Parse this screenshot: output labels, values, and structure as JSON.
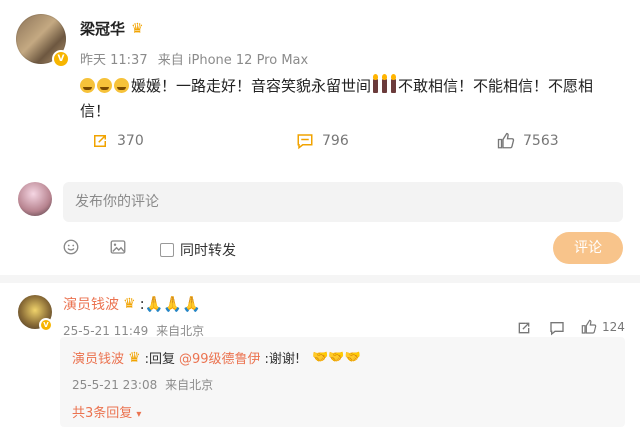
{
  "post": {
    "author": "梁冠华",
    "time": "昨天 11:37",
    "source": "来自 iPhone 12 Pro Max",
    "text": "媛媛！一路走好！音容笑貌永留世间",
    "text_suffix": "不敢相信！不能相信！不愿相",
    "text_line2": "信！",
    "repost_count": "370",
    "comment_count": "796",
    "like_count": "7563"
  },
  "composer": {
    "placeholder": "发布你的评论",
    "repost_label": "同时转发",
    "submit_label": "评论"
  },
  "comment": {
    "author": "演员钱波",
    "text": ":🙏🙏🙏",
    "time": "25-5-21 11:49",
    "location": "来自北京",
    "like_count": "124"
  },
  "reply": {
    "author": "演员钱波",
    "prefix": ":回复",
    "mention": "@99级德鲁伊",
    "text": ":谢谢!",
    "emoji": "🤝🤝🤝",
    "time": "25-5-21 23:08",
    "location": "来自北京",
    "more_label": "共3条回复"
  },
  "colors": {
    "accent": "#eb7350",
    "action": "#f1a300",
    "submit_bg": "#f8c48b"
  }
}
